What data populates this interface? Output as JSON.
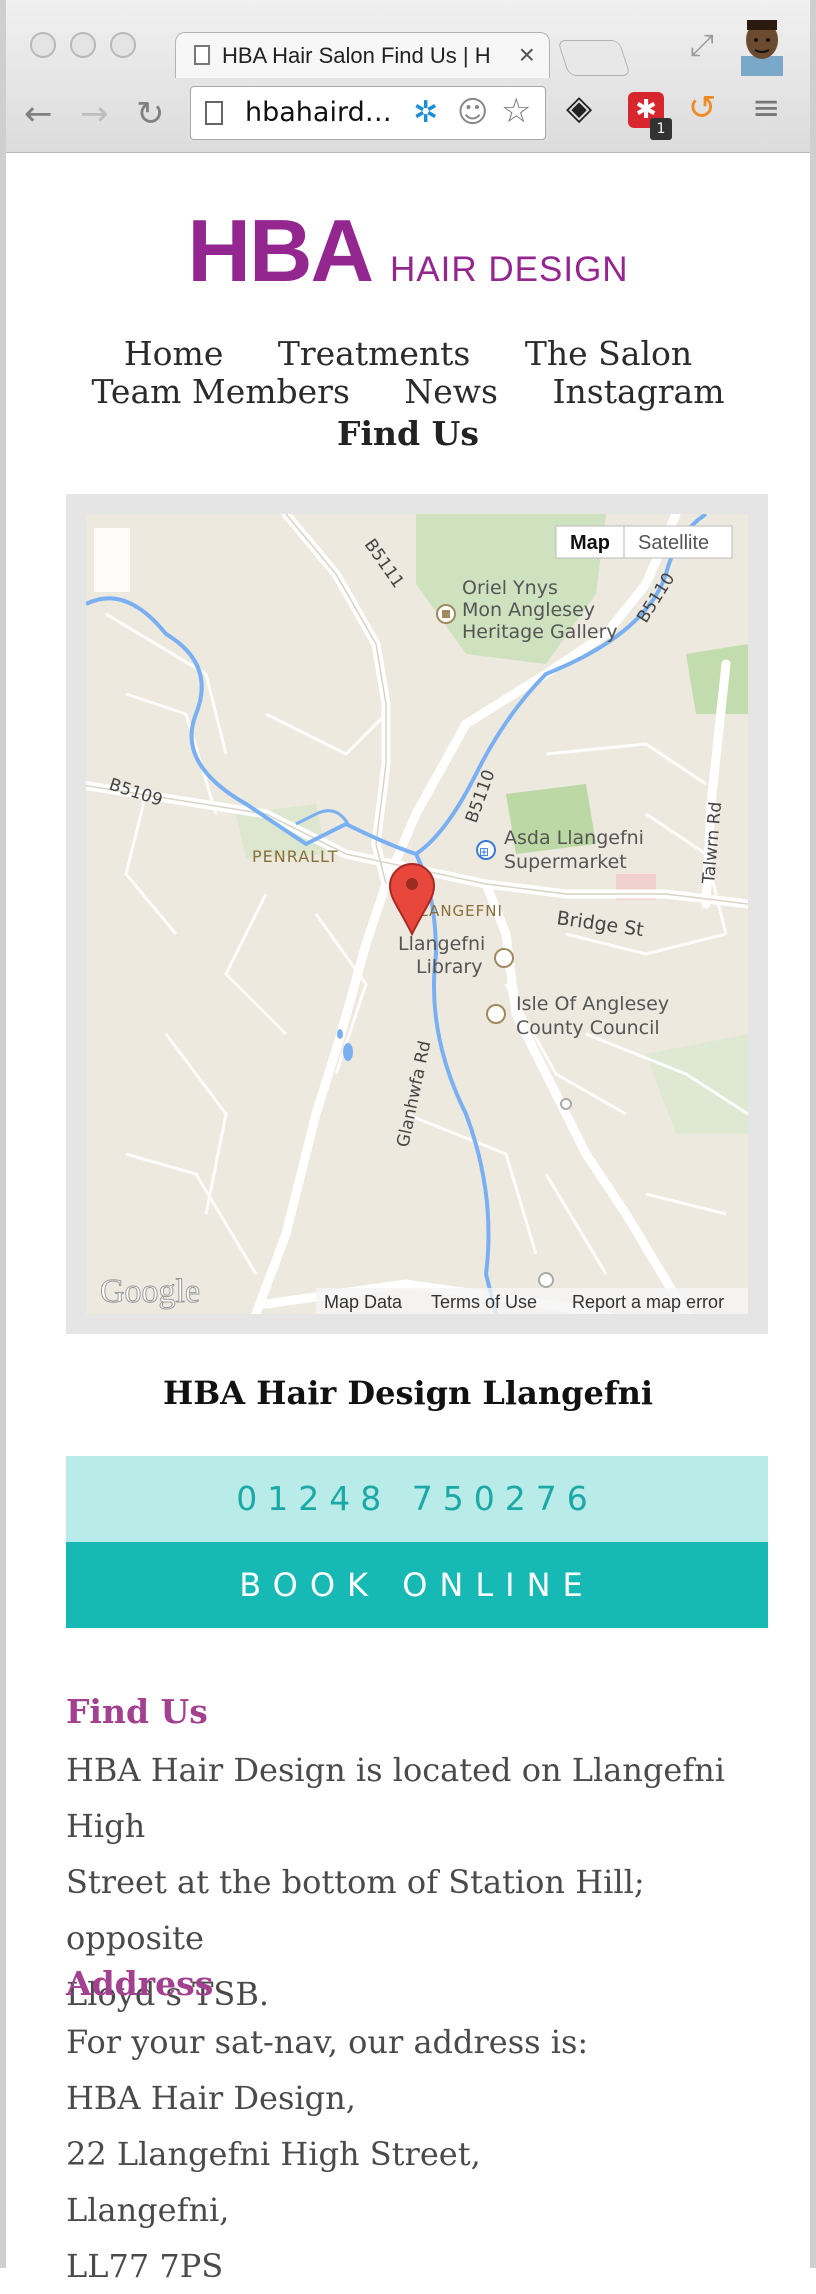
{
  "browser": {
    "tab_title": "HBA Hair Salon Find Us | HBA",
    "close_glyph": "×",
    "url": "hbahaird…",
    "back_glyph": "←",
    "forward_glyph": "→",
    "reload_glyph": "↻",
    "bookmark_glyph": "☆",
    "menu_glyph": "≡",
    "extension_badge": "1",
    "icons": [
      "back-icon",
      "forward-icon",
      "reload-icon",
      "page-icon",
      "bookmark-star-icon",
      "layers-icon",
      "extension-icon",
      "refresh-ring-icon",
      "menu-icon"
    ]
  },
  "logo": {
    "primary": "HBA",
    "secondary": "HAIR DESIGN",
    "color": "#93278f"
  },
  "nav": {
    "row1": [
      "Home",
      "Treatments",
      "The Salon"
    ],
    "row2": [
      "Team Members",
      "News",
      "Instagram"
    ],
    "active": "Find Us"
  },
  "map": {
    "btn_map": "Map",
    "btn_satellite": "Satellite",
    "road_labels": [
      "B5111",
      "B5110",
      "B5110",
      "B5109",
      "Talwrn Rd",
      "Bridge St",
      "Glanhwfa Rd"
    ],
    "places": {
      "gallery": [
        "Oriel Ynys",
        "Mon Anglesey",
        "Heritage Gallery"
      ],
      "supermarket": [
        "Asda Llangefni",
        "Supermarket"
      ],
      "penrallt": "PENRALLT",
      "llangefni": "LLANGEFNI",
      "library": [
        "Llangefni",
        "Library"
      ],
      "council": [
        "Isle Of Anglesey",
        "County Council"
      ]
    },
    "google": "Google",
    "map_data": "Map Data",
    "terms": "Terms of Use",
    "report": "Report a map error"
  },
  "salon_name": "HBA Hair Design Llangefni",
  "phone": "01248 750276",
  "book_label": "BOOK ONLINE",
  "accent_teal": "#17b9b4",
  "find_us": {
    "heading": "Find Us",
    "lines": [
      "HBA Hair Design is located on Llangefni High",
      "Street at the bottom of Station Hill; opposite",
      "Lloyd’s TSB."
    ]
  },
  "address": {
    "heading": "Address",
    "lines": [
      "For your sat-nav, our address is:",
      "HBA Hair Design,",
      "22 Llangefni High Street,",
      "Llangefni,",
      "LL77 7PS"
    ]
  }
}
